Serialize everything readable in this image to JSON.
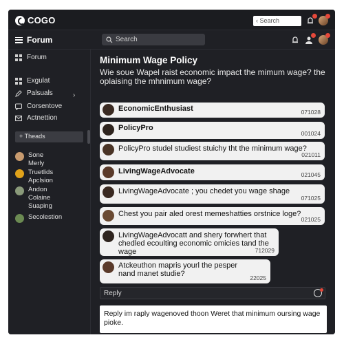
{
  "app": {
    "logo_text": "COGO"
  },
  "topbar": {
    "search_label": "Search"
  },
  "header": {
    "title": "Forum",
    "search_placeholder": "Search"
  },
  "sidebar": {
    "items": [
      {
        "label": "Forum",
        "icon": "grid-icon"
      },
      {
        "label": "Exgulat",
        "icon": "grid-icon"
      },
      {
        "label": "Palsuals",
        "icon": "edit-icon"
      },
      {
        "label": "Corsentove",
        "icon": "chat-icon"
      },
      {
        "label": "Actnettion",
        "icon": "mail-icon"
      }
    ],
    "threads_label": "Theads",
    "users": [
      {
        "name": "Sone\nMerly",
        "color": "#c89b6f"
      },
      {
        "name": "Truetlids\nApclsion",
        "color": "#e0a21a"
      },
      {
        "name": "Andon\nColaine\nSuaping",
        "color": "#8a9a7a"
      },
      {
        "name": "Secolestion",
        "color": "#6b8a52"
      }
    ]
  },
  "thread": {
    "title": "Minimum Wage Policy",
    "description": "Wie soue Wapel raist economic impact the mimum wage?  the oplaising the mhnimum wage?"
  },
  "messages": [
    {
      "text": "EconomicEnthusiast",
      "time": "071028"
    },
    {
      "text": "PolicyPro",
      "time": "001024"
    },
    {
      "text": "PolicyPro studel studiest stuichy tht the minimum wage?",
      "time": "021011"
    },
    {
      "text": "LivingWageAdvocate",
      "time": "021045"
    },
    {
      "text": "LivingWageAdvocate ; you chedet you wage shage",
      "time": "071025"
    },
    {
      "text": "Chest you pair aled orest memeshatties orstnice loge?",
      "time": "021025"
    },
    {
      "text": "LivingWageAdvocatt and shery forwhert that chedled ecoulting economic omicies tand the wage",
      "time": "712029"
    },
    {
      "text": "Atckeuthon mapris yourl the pesper nand manet studie?",
      "time": "22025"
    }
  ],
  "reply": {
    "label": "Reply",
    "draft": "Reply im raply wagenoved thoon Weret that minimum oursing wage pioke."
  },
  "colors": {
    "window_bg": "#1f2025",
    "bubble_bg": "#f1f1f1",
    "notification_badge": "#e5483a"
  }
}
